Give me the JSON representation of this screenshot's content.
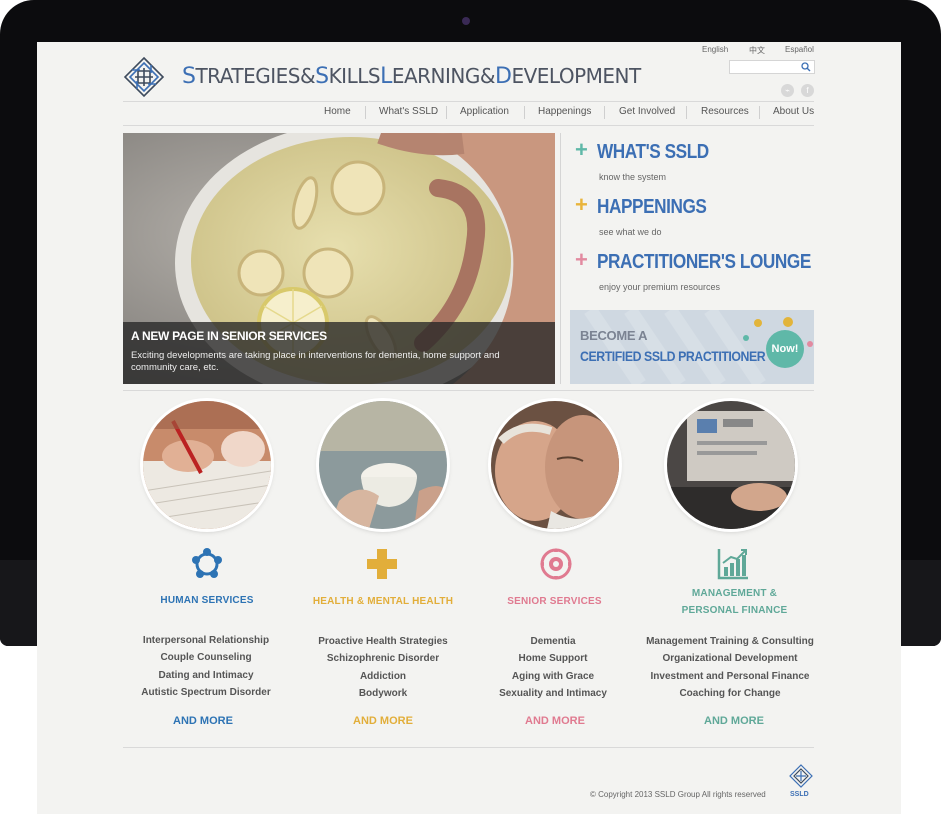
{
  "brand": {
    "title_parts": [
      {
        "cap": "S",
        "rest": "TRATEGIES "
      },
      {
        "amp": "& "
      },
      {
        "cap": "S",
        "rest": "KILLS "
      },
      {
        "cap": "L",
        "rest": "EARNING "
      },
      {
        "amp": "& "
      },
      {
        "cap": "D",
        "rest": "EVELOPMENT"
      }
    ],
    "color": "#3c6fb4"
  },
  "languages": [
    "English",
    "中文",
    "Español"
  ],
  "search": {
    "placeholder": ""
  },
  "social": [
    {
      "icon": "rss-icon",
      "glyph": "⌁"
    },
    {
      "icon": "facebook-icon",
      "glyph": "f"
    }
  ],
  "nav": [
    "Home",
    "What's SSLD",
    "Application",
    "Happenings",
    "Get Involved",
    "Resources",
    "About Us"
  ],
  "hero": {
    "title": "A NEW PAGE IN SENIOR SERVICES",
    "text": "Exciting developments are taking place in interventions for dementia, home support and community care, etc."
  },
  "panel": [
    {
      "plus": "+",
      "title": "WHAT'S SSLD",
      "sub": "know the system",
      "color": "#5fb8a8"
    },
    {
      "plus": "+",
      "title": "HAPPENINGS",
      "sub": "see what we do",
      "color": "#e9b43b"
    },
    {
      "plus": "+",
      "title": "PRACTITIONER'S LOUNGE",
      "sub": "enjoy your premium resources",
      "color": "#e28aa0"
    }
  ],
  "cert": {
    "line1": "BECOME A",
    "line2": "CERTIFIED SSLD PRACTITIONER",
    "badge": "Now!"
  },
  "categories": [
    {
      "title": "HUMAN SERVICES",
      "color": "#2d73b4",
      "icon": "people-circle-icon",
      "items": [
        "Interpersonal Relationship",
        "Couple Counseling",
        "Dating and Intimacy",
        "Autistic Spectrum Disorder"
      ],
      "more": "AND MORE"
    },
    {
      "title": "HEALTH & MENTAL HEALTH",
      "color": "#e2ae3a",
      "icon": "plus-cross-icon",
      "items": [
        "Proactive Health Strategies",
        "Schizophrenic Disorder",
        "Addiction",
        "Bodywork"
      ],
      "more": "AND MORE"
    },
    {
      "title": "SENIOR SERVICES",
      "color": "#e07a90",
      "icon": "lotus-icon",
      "items": [
        "Dementia",
        "Home Support",
        "Aging with Grace",
        "Sexuality and Intimacy"
      ],
      "more": "AND MORE"
    },
    {
      "title": "MANAGEMENT &\nPERSONAL FINANCE",
      "title_line1": "MANAGEMENT &",
      "title_line2": "PERSONAL FINANCE",
      "color": "#5fa898",
      "icon": "growth-chart-icon",
      "items": [
        "Management Training & Consulting",
        "Organizational Development",
        "Investment and Personal Finance",
        "Coaching for Change"
      ],
      "more": "AND MORE"
    }
  ],
  "footer": {
    "copyright": "© Copyright 2013 SSLD Group All rights reserved",
    "logo_label": "SSLD"
  }
}
